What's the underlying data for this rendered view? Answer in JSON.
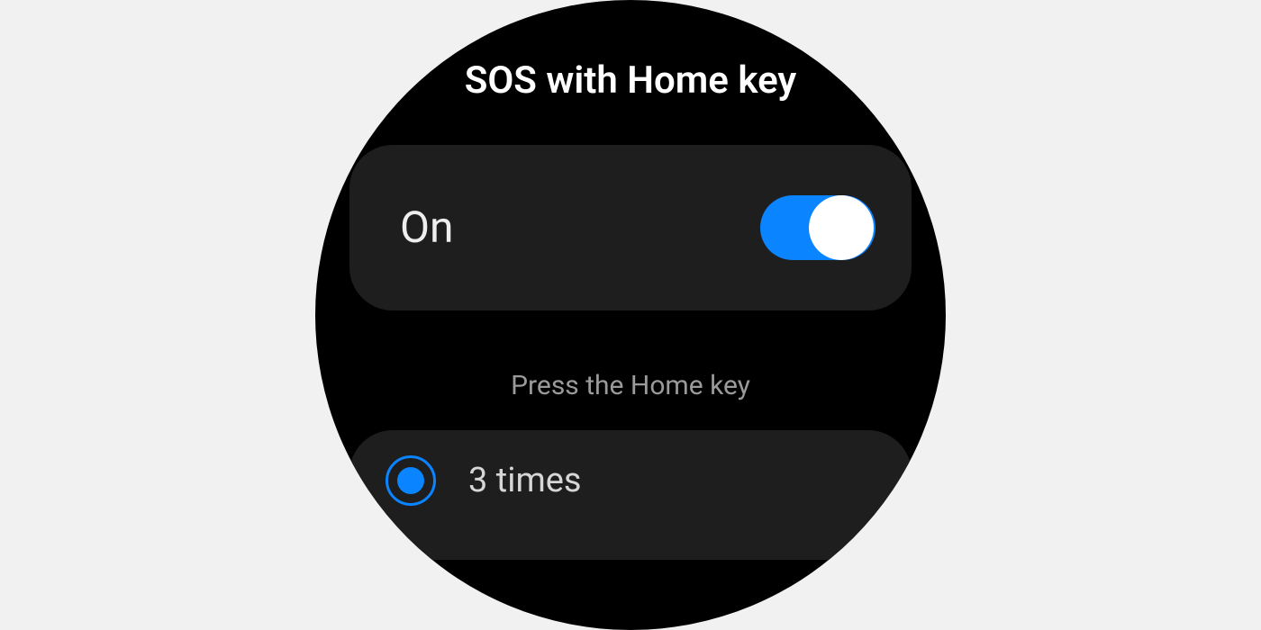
{
  "header": {
    "title": "SOS with Home key"
  },
  "toggle": {
    "label": "On",
    "state": "on"
  },
  "section": {
    "label": "Press the Home key"
  },
  "options": [
    {
      "label": "3 times",
      "selected": true
    }
  ],
  "colors": {
    "accent": "#0a84ff",
    "card": "#1e1e1e",
    "background": "#000000"
  }
}
